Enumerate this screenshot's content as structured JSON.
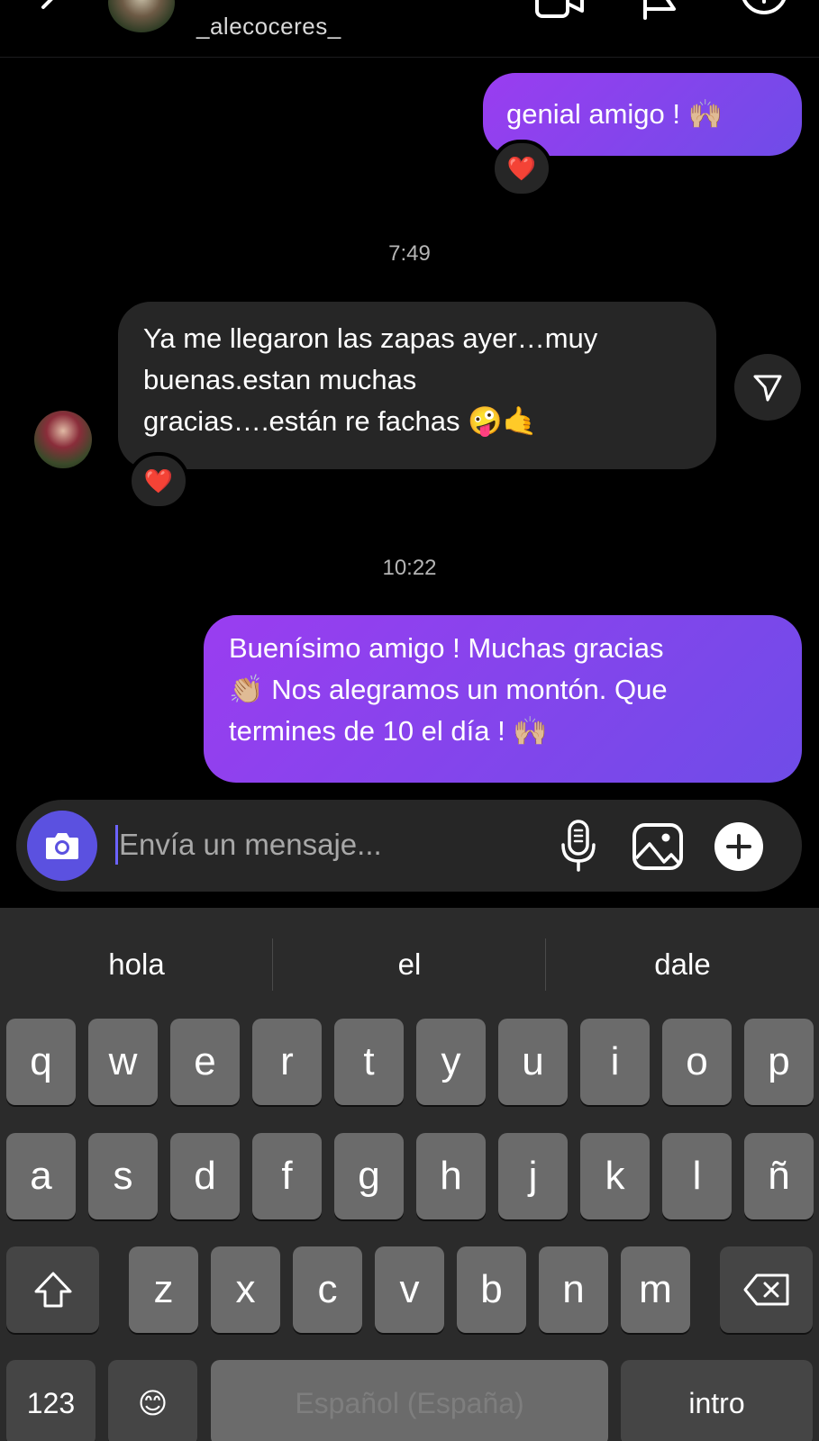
{
  "header": {
    "username": "_alecoceres_"
  },
  "messages": {
    "out1": {
      "text": "genial amigo ! 🙌🏼",
      "reaction": "❤️"
    },
    "time1": "7:49",
    "in1": {
      "line1": "Ya me llegaron las zapas ayer…muy",
      "line2": "buenas.estan muchas",
      "line3": "gracias….están re fachas 🤪🤙",
      "reaction": "❤️"
    },
    "time2": "10:22",
    "out2": {
      "line1": "Buenísimo amigo ! Muchas gracias",
      "line2": "👏🏼 Nos alegramos un montón. Que",
      "line3": "termines de 10 el día ! 🙌🏼"
    }
  },
  "composer": {
    "placeholder": "Envía un mensaje..."
  },
  "keyboard": {
    "suggestions": [
      "hola",
      "el",
      "dale"
    ],
    "row1": [
      "q",
      "w",
      "e",
      "r",
      "t",
      "y",
      "u",
      "i",
      "o",
      "p"
    ],
    "row2": [
      "a",
      "s",
      "d",
      "f",
      "g",
      "h",
      "j",
      "k",
      "l",
      "ñ"
    ],
    "row3": [
      "z",
      "x",
      "c",
      "v",
      "b",
      "n",
      "m"
    ],
    "numbers_label": "123",
    "space_label": "Español (España)",
    "return_label": "intro",
    "emoji_label": "😊"
  },
  "icons": {
    "back": "chevron-left-icon",
    "video": "video-camera-icon",
    "flag": "flag-icon",
    "info": "info-icon",
    "share": "send-icon",
    "camera": "camera-icon",
    "mic": "microphone-icon",
    "gallery": "image-icon",
    "plus": "plus-icon",
    "shift": "shift-icon",
    "delete": "backspace-icon"
  },
  "colors": {
    "accent": "#6f4ce8",
    "outgoing_start": "#9a3df0",
    "incoming": "#262626",
    "camera_button": "#5b51e0"
  }
}
